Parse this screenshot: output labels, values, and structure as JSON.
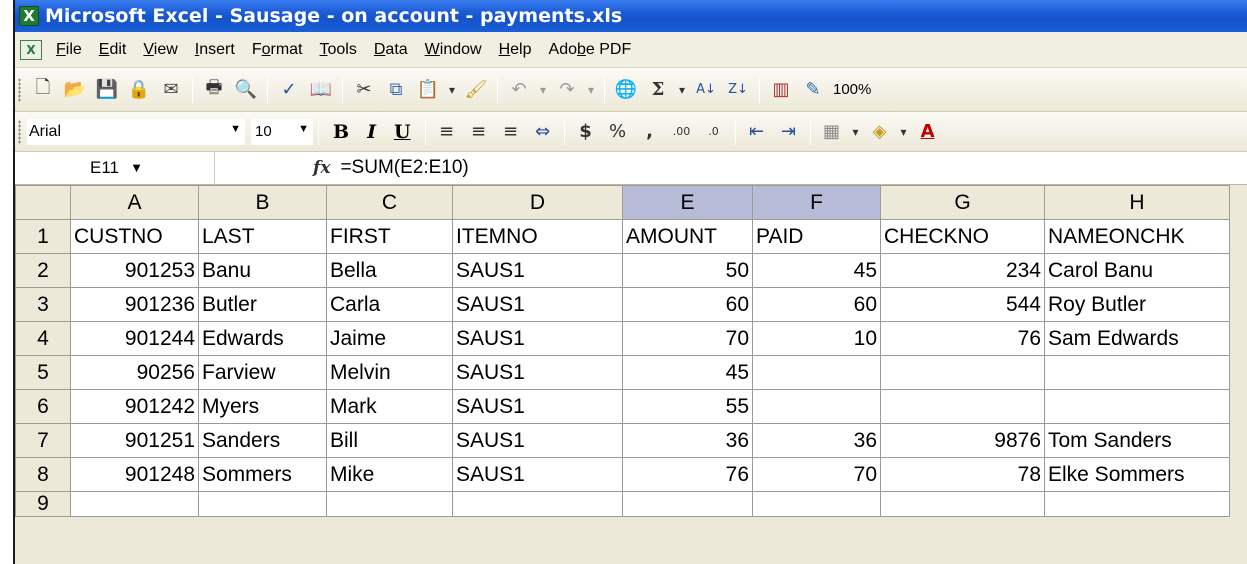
{
  "window": {
    "title": "Microsoft Excel - Sausage - on account - payments.xls"
  },
  "menu": [
    {
      "label": "File",
      "u": "F",
      "rest": "ile"
    },
    {
      "label": "Edit",
      "u": "E",
      "rest": "dit"
    },
    {
      "label": "View",
      "u": "V",
      "rest": "iew"
    },
    {
      "label": "Insert",
      "u": "I",
      "rest": "nsert"
    },
    {
      "label": "Format",
      "pre": "F",
      "u": "o",
      "rest": "rmat"
    },
    {
      "label": "Tools",
      "u": "T",
      "rest": "ools"
    },
    {
      "label": "Data",
      "u": "D",
      "rest": "ata"
    },
    {
      "label": "Window",
      "u": "W",
      "rest": "indow"
    },
    {
      "label": "Help",
      "u": "H",
      "rest": "elp"
    },
    {
      "label": "Adobe PDF",
      "pre": "Ado",
      "u": "b",
      "rest": "e PDF"
    }
  ],
  "toolbar": {
    "zoom": "100%"
  },
  "format_toolbar": {
    "font": "Arial",
    "size": "10",
    "bold": "B",
    "italic": "I",
    "underline": "U"
  },
  "formula_bar": {
    "cell_ref": "E11",
    "fx": "fx",
    "formula": "=SUM(E2:E10)"
  },
  "grid": {
    "columns": [
      "A",
      "B",
      "C",
      "D",
      "E",
      "F",
      "G",
      "H"
    ],
    "selected_columns": [
      "E",
      "F"
    ],
    "rows": [
      {
        "n": "1",
        "cells": [
          "CUSTNO",
          "LAST",
          "FIRST",
          "ITEMNO",
          "AMOUNT",
          "PAID",
          "CHECKNO",
          "NAMEONCHK"
        ]
      },
      {
        "n": "2",
        "cells": [
          "901253",
          "Banu",
          "Bella",
          "SAUS1",
          "50",
          "45",
          "234",
          "Carol Banu"
        ]
      },
      {
        "n": "3",
        "cells": [
          "901236",
          "Butler",
          "Carla",
          "SAUS1",
          "60",
          "60",
          "544",
          "Roy Butler"
        ]
      },
      {
        "n": "4",
        "cells": [
          "901244",
          "Edwards",
          "Jaime",
          "SAUS1",
          "70",
          "10",
          "76",
          "Sam Edwards"
        ]
      },
      {
        "n": "5",
        "cells": [
          "90256",
          "Farview",
          "Melvin",
          "SAUS1",
          "45",
          "",
          "",
          ""
        ]
      },
      {
        "n": "6",
        "cells": [
          "901242",
          "Myers",
          "Mark",
          "SAUS1",
          "55",
          "",
          "",
          ""
        ]
      },
      {
        "n": "7",
        "cells": [
          "901251",
          "Sanders",
          "Bill",
          "SAUS1",
          "36",
          "36",
          "9876",
          "Tom Sanders"
        ]
      },
      {
        "n": "8",
        "cells": [
          "901248",
          "Sommers",
          "Mike",
          "SAUS1",
          "76",
          "70",
          "78",
          "Elke Sommers"
        ]
      },
      {
        "n": "9",
        "cells": [
          "",
          "",
          "",
          "",
          "",
          "",
          "",
          ""
        ]
      }
    ]
  }
}
